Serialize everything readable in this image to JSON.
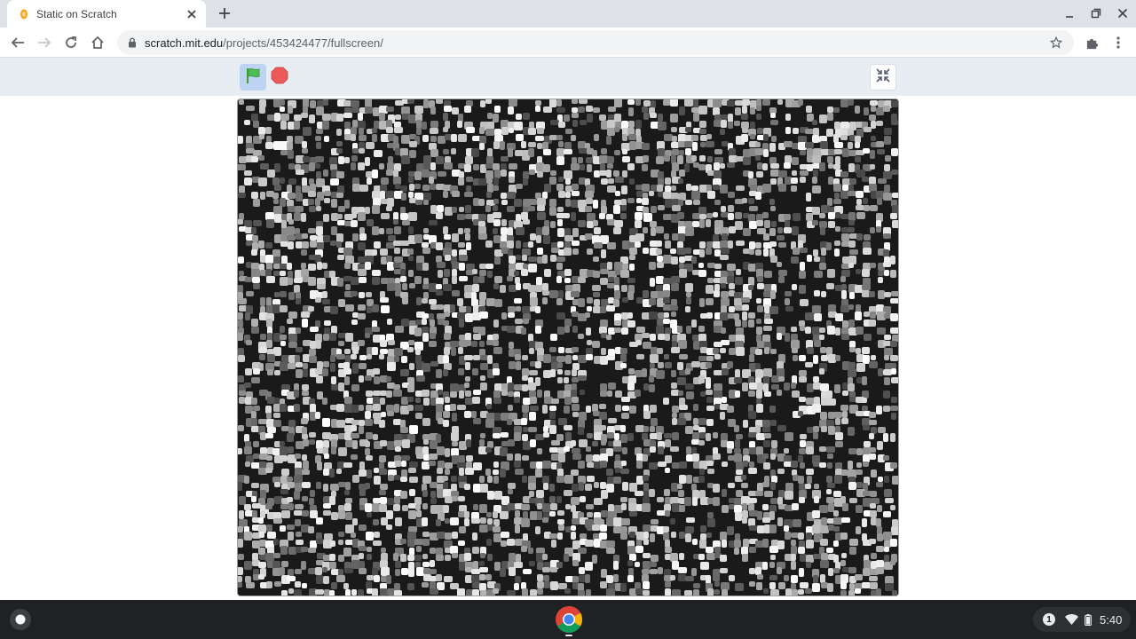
{
  "tab": {
    "title": "Static on Scratch"
  },
  "omnibox": {
    "host": "scratch.mit.edu",
    "path": "/projects/453424477/fullscreen/"
  },
  "scratch": {
    "stage_content": "tv-static-noise"
  },
  "shelf": {
    "notification_count": "1",
    "time": "5:40"
  },
  "colors": {
    "flag_green": "#4cbf56",
    "stop_red": "#ec5959",
    "header_bg": "#e8edf1",
    "shelf_bg": "#202124"
  },
  "icons": {
    "favicon": "scratch-cat-icon",
    "close": "close-icon",
    "newtab": "plus-icon",
    "back": "arrow-left-icon",
    "forward": "arrow-right-icon",
    "reload": "reload-icon",
    "home": "home-icon",
    "lock": "lock-icon",
    "star": "star-icon",
    "extensions": "puzzle-icon",
    "menu": "kebab-menu-icon",
    "flag": "green-flag-icon",
    "stop": "stop-icon",
    "exit_fullscreen": "unfullscreen-icon",
    "launcher": "launcher-icon",
    "chrome": "chrome-icon",
    "wifi": "wifi-icon",
    "battery": "battery-icon"
  }
}
